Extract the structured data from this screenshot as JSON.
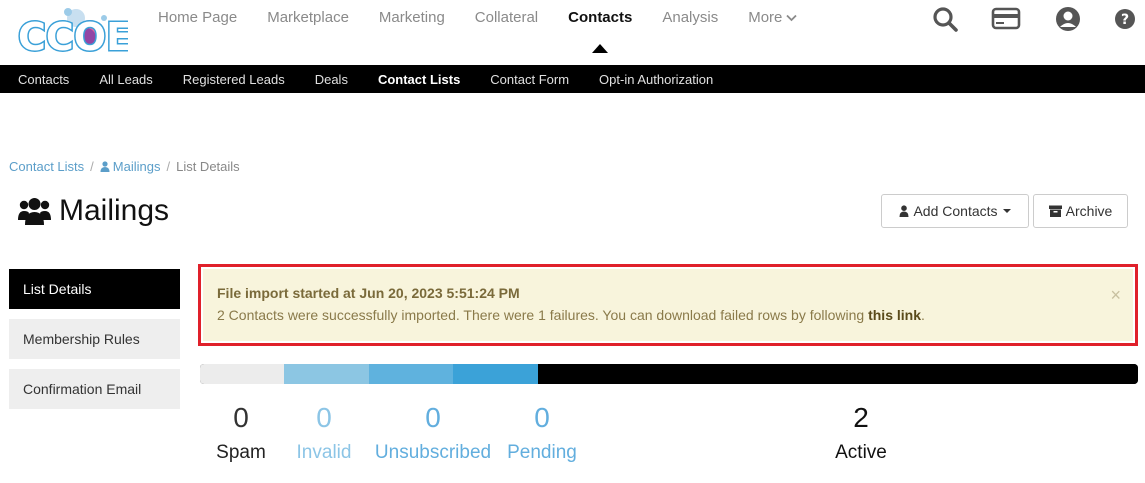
{
  "colors": {
    "accent_blue": "#5b9ec9",
    "stat_blue": "#62aede",
    "invalid_blue": "#8cc5e6",
    "alert_bg": "#f8f4dc",
    "alert_border": "#e0202a",
    "seg_spam": "#ececec",
    "seg_invalid": "#8cc6e3",
    "seg_unsub": "#5fb2de",
    "seg_pending": "#3ba2d8",
    "seg_active": "#000000"
  },
  "logo": {
    "text": "CCOE"
  },
  "mainnav": {
    "items": [
      {
        "label": "Home Page"
      },
      {
        "label": "Marketplace"
      },
      {
        "label": "Marketing"
      },
      {
        "label": "Collateral"
      },
      {
        "label": "Contacts"
      },
      {
        "label": "Analysis"
      },
      {
        "label": "More"
      }
    ]
  },
  "icons": {
    "search": "search-icon",
    "card": "credit-card-icon",
    "user": "user-circle-icon",
    "help": "help-icon"
  },
  "subnav": {
    "items": [
      {
        "label": "Contacts"
      },
      {
        "label": "All Leads"
      },
      {
        "label": "Registered Leads"
      },
      {
        "label": "Deals"
      },
      {
        "label": "Contact Lists"
      },
      {
        "label": "Contact Form"
      },
      {
        "label": "Opt-in Authorization"
      }
    ]
  },
  "breadcrumb": {
    "items": [
      {
        "label": "Contact Lists"
      },
      {
        "label": "Mailings"
      },
      {
        "label": "List Details"
      }
    ],
    "separator": "/"
  },
  "page": {
    "title": "Mailings"
  },
  "buttons": {
    "add_contacts": "Add Contacts",
    "archive": "Archive"
  },
  "sidemenu": {
    "items": [
      {
        "label": "List Details"
      },
      {
        "label": "Membership Rules"
      },
      {
        "label": "Confirmation Email"
      }
    ]
  },
  "alert": {
    "title": "File import started at Jun 20, 2023 5:51:24 PM",
    "body": "2 Contacts were successfully imported. There were 1 failures. You can download failed rows by following ",
    "link": "this link",
    "suffix": ".",
    "close": "×"
  },
  "stats": [
    {
      "value": "0",
      "label": "Spam"
    },
    {
      "value": "0",
      "label": "Invalid"
    },
    {
      "value": "0",
      "label": "Unsubscribed"
    },
    {
      "value": "0",
      "label": "Pending"
    },
    {
      "value": "2",
      "label": "Active"
    }
  ],
  "progress": {
    "segments": [
      {
        "name": "spam",
        "fraction": 0.09
      },
      {
        "name": "invalid",
        "fraction": 0.09
      },
      {
        "name": "unsubscribed",
        "fraction": 0.09
      },
      {
        "name": "pending",
        "fraction": 0.09
      },
      {
        "name": "active",
        "fraction": 0.64
      }
    ]
  }
}
